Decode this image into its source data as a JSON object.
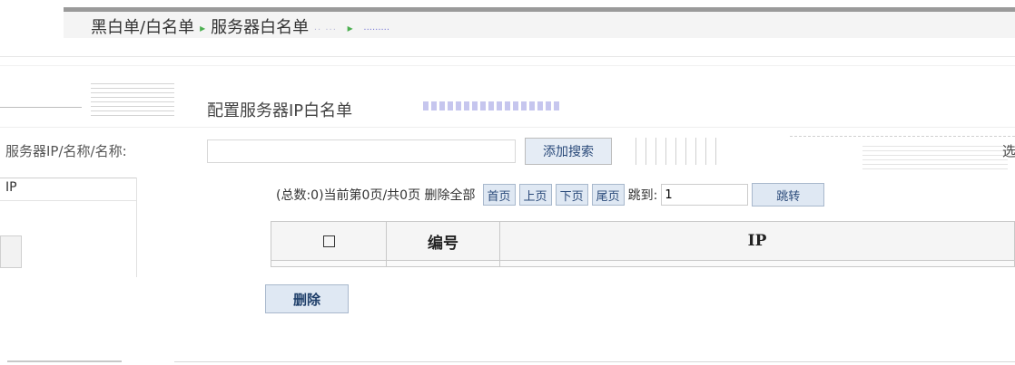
{
  "breadcrumb": {
    "parent": "黑白单/白名单",
    "separator": "▸",
    "current": "服务器白名单",
    "faint_a": "·· ···",
    "arrow": "▸",
    "faint_b": "·········"
  },
  "section": {
    "title": "配置服务器IP白名单"
  },
  "search": {
    "label": "服务器IP/名称/名称:",
    "input_value": "",
    "button_label": "添加搜索",
    "right_char": "选"
  },
  "left_panel": {
    "tab_label": "IP"
  },
  "pagination": {
    "info": "(总数:0)当前第0页/共0页 删除全部",
    "first_label": "首页",
    "prev_label": "上页",
    "next_label": "下页",
    "last_label": "尾页",
    "goto_label": "跳到:",
    "page_value": "1",
    "go_label": "跳转"
  },
  "table": {
    "columns": [
      "",
      "编号",
      "IP"
    ]
  },
  "actions": {
    "delete_label": "删除"
  }
}
